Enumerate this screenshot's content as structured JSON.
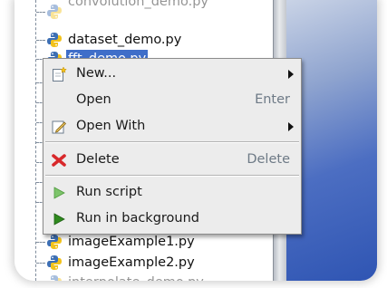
{
  "file_tree": {
    "items": [
      {
        "label": "convolution_demo.py"
      },
      {
        "label": "dataset_demo.py"
      },
      {
        "label": "fft_demo.py"
      },
      {
        "label": ""
      },
      {
        "label": ""
      },
      {
        "label": ""
      },
      {
        "label": ""
      },
      {
        "label": ""
      },
      {
        "label": ""
      },
      {
        "label": ""
      },
      {
        "label": "imageExample1.py"
      },
      {
        "label": "imageExample2.py"
      },
      {
        "label": "interpolate_demo.py"
      }
    ],
    "icon": "python-file-icon"
  },
  "context_menu": {
    "items": [
      {
        "label": "New...",
        "accelerator": "",
        "icon": "new-file-icon",
        "submenu": true
      },
      {
        "label": "Open",
        "accelerator": "Enter",
        "icon": "",
        "submenu": false
      },
      {
        "label": "Open With",
        "accelerator": "",
        "icon": "edit-icon",
        "submenu": true
      },
      {
        "label": "Delete",
        "accelerator": "Delete",
        "icon": "delete-icon",
        "submenu": false
      },
      {
        "label": "Run script",
        "accelerator": "",
        "icon": "run-icon",
        "submenu": false
      },
      {
        "label": "Run in background",
        "accelerator": "",
        "icon": "run-background-icon",
        "submenu": false
      }
    ]
  },
  "colors": {
    "selection": "#3f6ec9",
    "menu_background": "#ececec",
    "accelerator_text": "#6e7a86",
    "delete_icon": "#d8282b",
    "run_icon_light": "#7dc46b",
    "run_icon_dark": "#2f8a1e"
  }
}
